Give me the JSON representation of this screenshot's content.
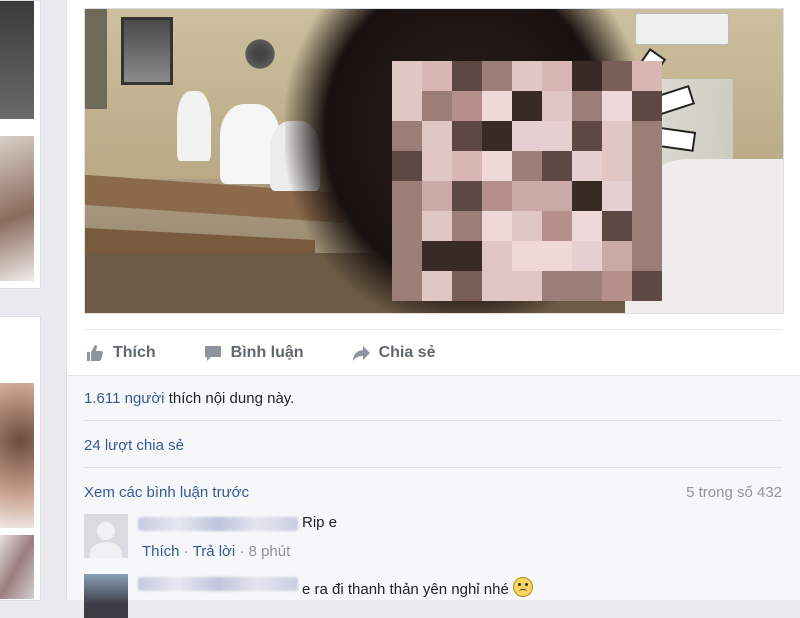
{
  "post": {
    "actions": {
      "like_label": "Thích",
      "comment_label": "Bình luận",
      "share_label": "Chia sẻ"
    },
    "likes": {
      "count": "1.611",
      "people_word": "người",
      "suffix": "thích nội dung này."
    },
    "shares_text": "24 lượt chia sẻ",
    "comments": {
      "view_previous": "Xem các bình luận trước",
      "count_text": "5 trong số 432",
      "items": [
        {
          "text": "Rip e",
          "like_label": "Thích",
          "reply_label": "Trả lời",
          "time": "8 phút"
        },
        {
          "text": "e ra đi thanh thản yên nghỉ nhé"
        }
      ]
    }
  },
  "colors": {
    "link": "#365899",
    "muted": "#90949c",
    "action": "#606770",
    "page_bg": "#e9ebee"
  },
  "icons": [
    "thumbs-up-icon",
    "comment-icon",
    "share-icon",
    "frown-emoji-icon",
    "default-avatar-icon"
  ]
}
